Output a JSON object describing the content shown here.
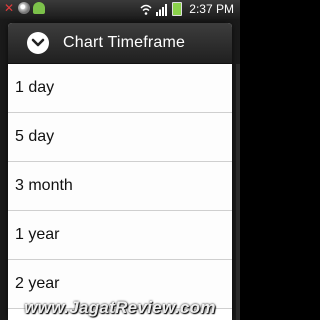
{
  "status_bar": {
    "time": "2:37 PM",
    "icons": [
      "missed-notification-icon",
      "media-disc-icon",
      "android-debug-icon",
      "wifi-icon",
      "signal-icon",
      "battery-icon"
    ]
  },
  "dialog": {
    "title": "Chart Timeframe",
    "header_icon": "chevron-down-circle-icon",
    "options": [
      {
        "label": "1 day"
      },
      {
        "label": "5 day"
      },
      {
        "label": "3 month"
      },
      {
        "label": "1 year"
      },
      {
        "label": "2 year"
      }
    ]
  },
  "watermark": "www.JagatReview.com",
  "colors": {
    "header_bg": "#2b2b2b",
    "list_bg": "#fdfdfd",
    "divider": "#cfcfcf",
    "text": "#111111"
  }
}
